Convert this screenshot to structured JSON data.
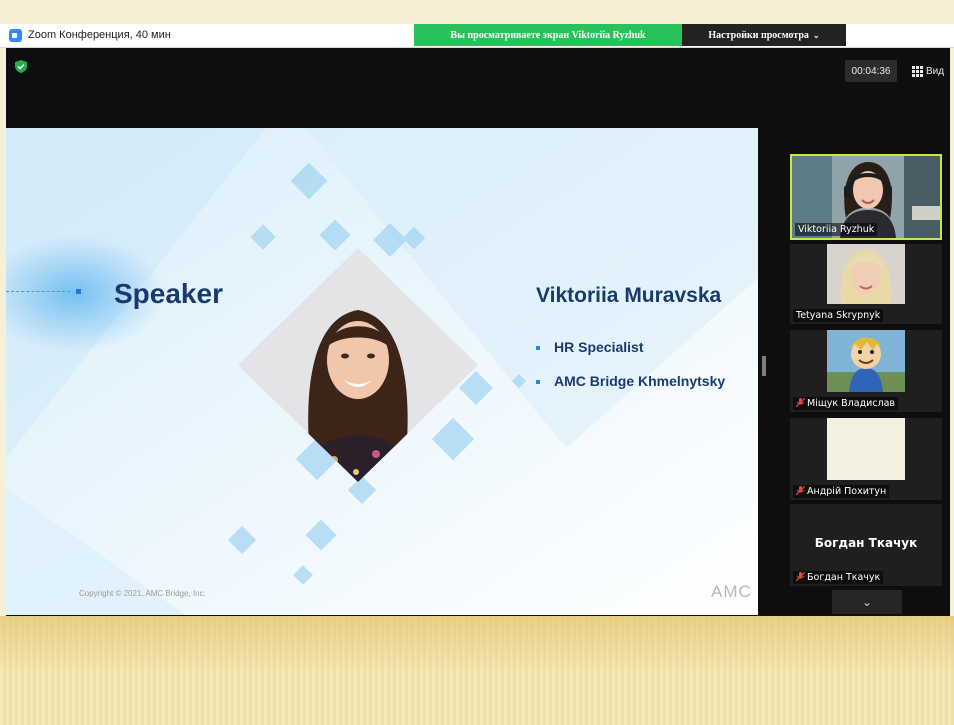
{
  "titlebar": {
    "app_title": "Zoom Конференция, 40 мин"
  },
  "banner": {
    "sharing_text": "Вы просматриваете экран Viktoriia Ryzhuk",
    "view_settings_label": "Настройки просмотра"
  },
  "meeting": {
    "timer": "00:04:36",
    "view_label": "Вид"
  },
  "slide": {
    "heading": "Speaker",
    "name": "Viktoriia Muravska",
    "roles": [
      "HR Specialist",
      "AMC Bridge Khmelnytsky"
    ],
    "copyright": "Copyright © 2021, AMC Bridge, Inc.",
    "logo_text": "AMC"
  },
  "participants": [
    {
      "name": "Viktoriia Ryzhuk",
      "muted": false,
      "active": true
    },
    {
      "name": "Tetyana Skrypnyk",
      "muted": false,
      "active": false
    },
    {
      "name": "Міщук Владислав",
      "muted": true,
      "active": false
    },
    {
      "name": "Андрій Похитун",
      "muted": true,
      "active": false
    },
    {
      "name": "Богдан Ткачук",
      "muted": true,
      "active": false,
      "no_video_label": "Богдан Ткачук"
    }
  ],
  "colors": {
    "active_speaker_border": "#c8e64a",
    "share_banner": "#27c25a",
    "slide_text": "#1a3a6b",
    "muted_mic": "#e8453c"
  },
  "icons": {
    "app": "zoom-app-icon",
    "security": "shield-check-icon",
    "view": "grid-icon",
    "muted": "mic-muted-icon",
    "scroll": "chevron-down-icon"
  }
}
